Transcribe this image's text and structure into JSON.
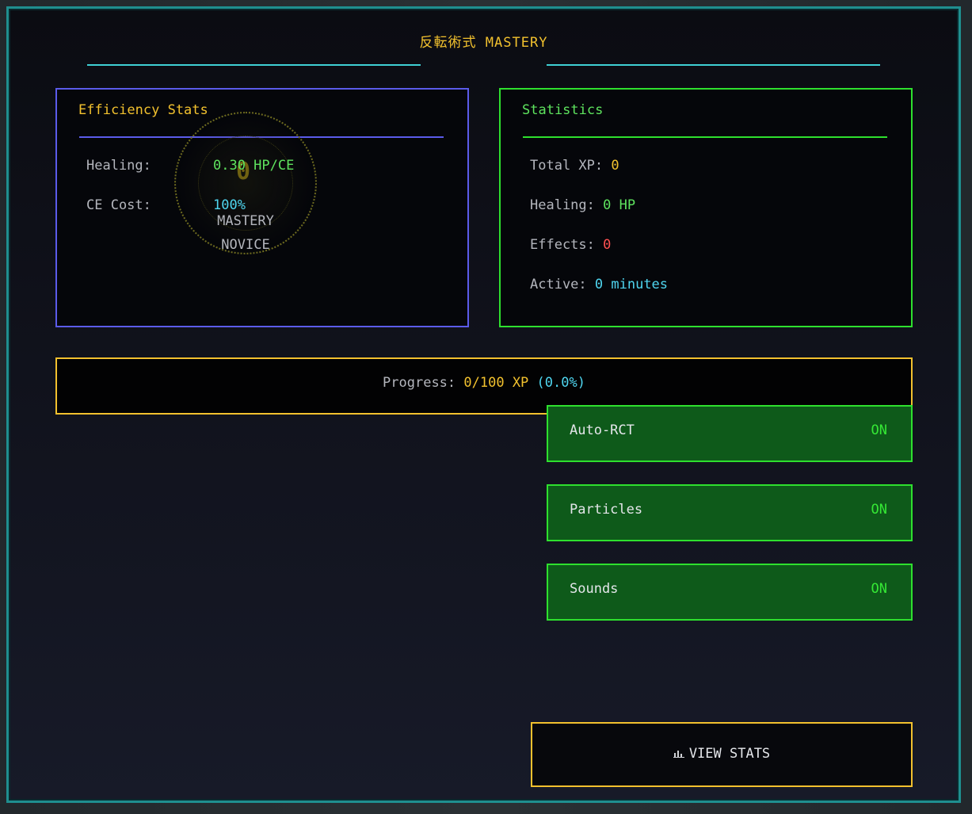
{
  "header": {
    "title_kanji": "反転術式",
    "title_word": "MASTERY"
  },
  "efficiency": {
    "title": "Efficiency Stats",
    "healing_label": "Healing:",
    "healing_value": "0.30 HP/CE",
    "ce_cost_label": "CE Cost:",
    "ce_cost_value": "100%",
    "level": "0",
    "mastery_label": "MASTERY",
    "rank": "NOVICE"
  },
  "statistics": {
    "title": "Statistics",
    "total_xp_label": "Total XP:",
    "total_xp_value": "0",
    "healing_label": "Healing:",
    "healing_value": "0 HP",
    "effects_label": "Effects:",
    "effects_value": "0",
    "active_label": "Active:",
    "active_value": "0 minutes"
  },
  "progress": {
    "label": "Progress:",
    "value": "0/100 XP",
    "percent": "(0.0%)",
    "fraction": 0.0
  },
  "toggles": [
    {
      "label": "Auto-RCT",
      "state": "ON"
    },
    {
      "label": "Particles",
      "state": "ON"
    },
    {
      "label": "Sounds",
      "state": "ON"
    }
  ],
  "view_stats": {
    "icon": "bar-chart-icon",
    "label": "VIEW STATS"
  },
  "colors": {
    "accent_gold": "#f2c12e",
    "accent_cyan": "#3fd0d4",
    "panel_blue": "#5b5bea",
    "panel_green": "#2ee02e",
    "toggle_bg": "#0e5a1a"
  }
}
